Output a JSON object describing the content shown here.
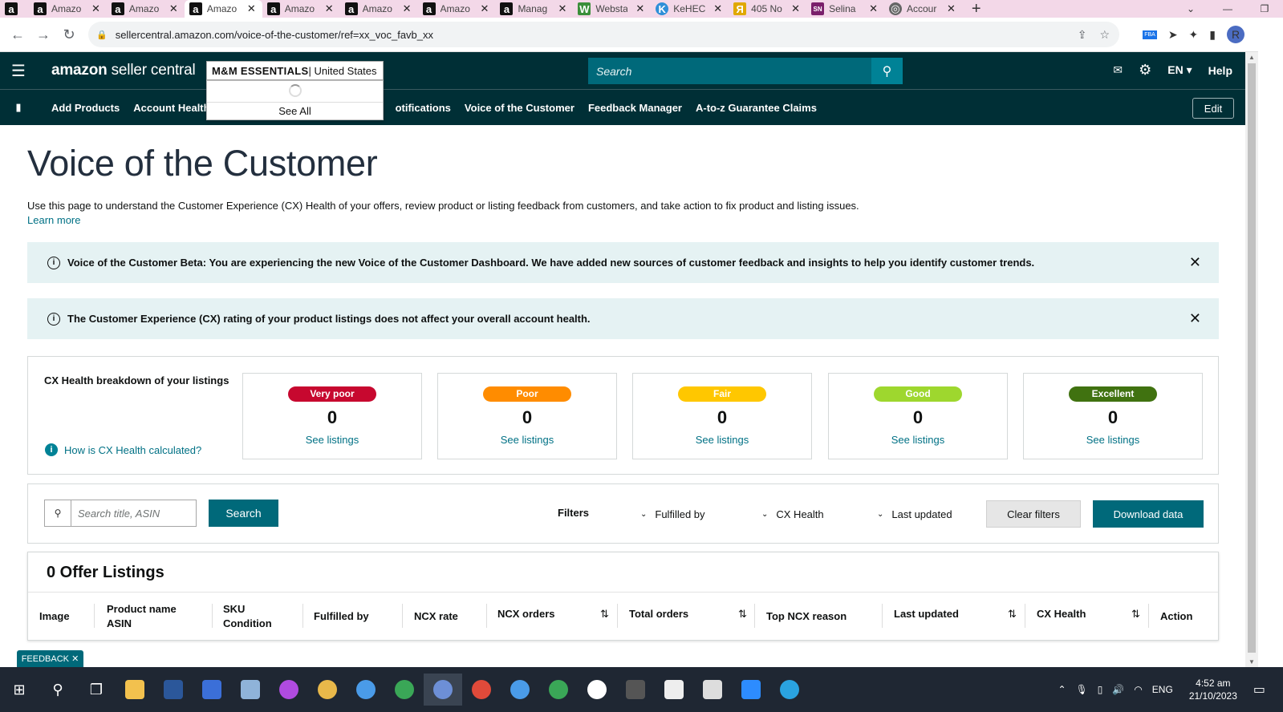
{
  "browser": {
    "tabs": [
      {
        "label": "",
        "icon": "amazon-icon"
      },
      {
        "label": "Amazo",
        "icon": "amazon-icon"
      },
      {
        "label": "Amazo",
        "icon": "amazon-icon"
      },
      {
        "label": "Amazo",
        "icon": "amazon-icon",
        "active": true
      },
      {
        "label": "Amazo",
        "icon": "amazon-icon"
      },
      {
        "label": "Amazo",
        "icon": "amazon-icon"
      },
      {
        "label": "Amazo",
        "icon": "amazon-icon"
      },
      {
        "label": "Manag",
        "icon": "amazon-icon"
      },
      {
        "label": "Websta",
        "icon": "webstaurant-icon"
      },
      {
        "label": "KeHEC",
        "icon": "kehe-icon"
      },
      {
        "label": "405 No",
        "icon": "browser-icon"
      },
      {
        "label": "Selina",
        "icon": "sn-icon"
      },
      {
        "label": "Accour",
        "icon": "globe-icon"
      }
    ],
    "url": "sellercentral.amazon.com/voice-of-the-customer/ref=xx_voc_favb_xx"
  },
  "header": {
    "brand_bold": "amazon",
    "brand_rest": " seller central",
    "store_name": "M&M ESSENTIALS",
    "store_region": " | United States",
    "search_placeholder": "Search",
    "language": "EN",
    "help": "Help"
  },
  "store_dropdown": {
    "see_all": "See All"
  },
  "nav": {
    "items": [
      "Add Products",
      "Account Health",
      "otifications",
      "Voice of the Customer",
      "Feedback Manager",
      "A-to-z Guarantee Claims"
    ],
    "edit": "Edit"
  },
  "page": {
    "title": "Voice of the Customer",
    "intro": "Use this page to understand the Customer Experience (CX) Health of your offers, review product or listing feedback from customers, and take action to fix product and listing issues.",
    "learn_more": "Learn more"
  },
  "banners": [
    "Voice of the Customer Beta: You are experiencing the new Voice of the Customer Dashboard. We have added new sources of customer feedback and insights to help you identify customer trends.",
    "The Customer Experience (CX) rating of your product listings does not affect your overall account health."
  ],
  "cx": {
    "title": "CX Health breakdown of your listings",
    "how": "How is CX Health calculated?",
    "cards": [
      {
        "label": "Very poor",
        "count": "0",
        "link": "See listings",
        "color": "#c7082f"
      },
      {
        "label": "Poor",
        "count": "0",
        "link": "See listings",
        "color": "#ff8c00"
      },
      {
        "label": "Fair",
        "count": "0",
        "link": "See listings",
        "color": "#ffc700"
      },
      {
        "label": "Good",
        "count": "0",
        "link": "See listings",
        "color": "#9ed72e"
      },
      {
        "label": "Excellent",
        "count": "0",
        "link": "See listings",
        "color": "#407210"
      }
    ]
  },
  "filters": {
    "search_placeholder": "Search title, ASIN",
    "search_button": "Search",
    "label": "Filters",
    "fulfilled_by": "Fulfilled by",
    "cx_health": "CX Health",
    "last_updated": "Last updated",
    "clear": "Clear filters",
    "download": "Download data"
  },
  "offers": {
    "title": "0 Offer Listings",
    "columns": {
      "image": "Image",
      "product_line1": "Product name",
      "product_line2": "ASIN",
      "sku_line1": "SKU",
      "sku_line2": "Condition",
      "fulfilled": "Fulfilled by",
      "ncx_rate": "NCX rate",
      "ncx_orders": "NCX orders",
      "total_orders": "Total orders",
      "top_reason": "Top NCX reason",
      "last_updated": "Last updated",
      "cx_health": "CX Health",
      "action": "Action"
    }
  },
  "feedback": "FEEDBACK",
  "taskbar": {
    "language": "ENG",
    "time": "4:52 am",
    "date": "21/10/2023"
  }
}
